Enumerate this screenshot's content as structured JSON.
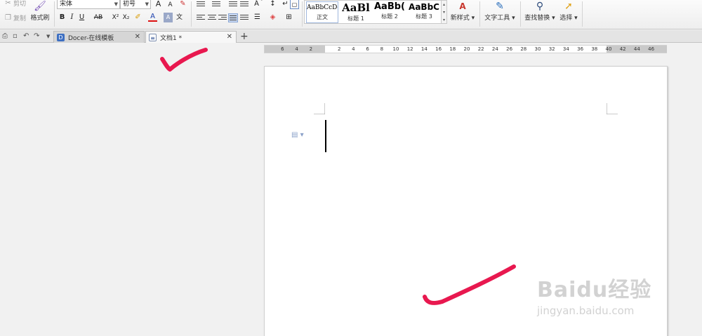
{
  "clipboard": {
    "cut": "剪切",
    "copy": "复制",
    "format_painter": "格式刷"
  },
  "font": {
    "name": "宋体",
    "size": "初号"
  },
  "format_buttons": {
    "bold": "B",
    "italic": "I",
    "underline": "U",
    "strike": "AB",
    "superscript": "X²",
    "subscript": "X₂",
    "grow": "A",
    "shrink": "A",
    "font_color": "A"
  },
  "styles": [
    {
      "sample": "AaBbCcDd",
      "label": "正文"
    },
    {
      "sample": "AaBl",
      "label": "标题 1"
    },
    {
      "sample": "AaBb(",
      "label": "标题 2"
    },
    {
      "sample": "AaBbC",
      "label": "标题 3"
    }
  ],
  "ribbon_buttons": {
    "new_style": "新样式",
    "text_tools": "文字工具",
    "find_replace": "查找替换",
    "select": "选择"
  },
  "tabs": [
    {
      "label": "Docer-在线模板",
      "active": false
    },
    {
      "label": "文档1 *",
      "active": true
    }
  ],
  "ruler_numbers": [
    "6",
    "4",
    "2",
    "2",
    "4",
    "6",
    "8",
    "10",
    "12",
    "14",
    "16",
    "18",
    "20",
    "22",
    "24",
    "26",
    "28",
    "30",
    "32",
    "34",
    "36",
    "38",
    "40",
    "42",
    "44",
    "46"
  ],
  "watermark": {
    "brand": "Baidu经验",
    "site": "jingyan.baidu.com"
  },
  "colors": {
    "annotation": "#e8184f",
    "accent": "#2a6ebb"
  },
  "icons": [
    "scissors-icon",
    "copy-icon",
    "brush-icon",
    "print-icon",
    "undo-icon",
    "redo-icon",
    "close-icon",
    "plus-icon",
    "binoculars-icon",
    "cursor-icon"
  ]
}
